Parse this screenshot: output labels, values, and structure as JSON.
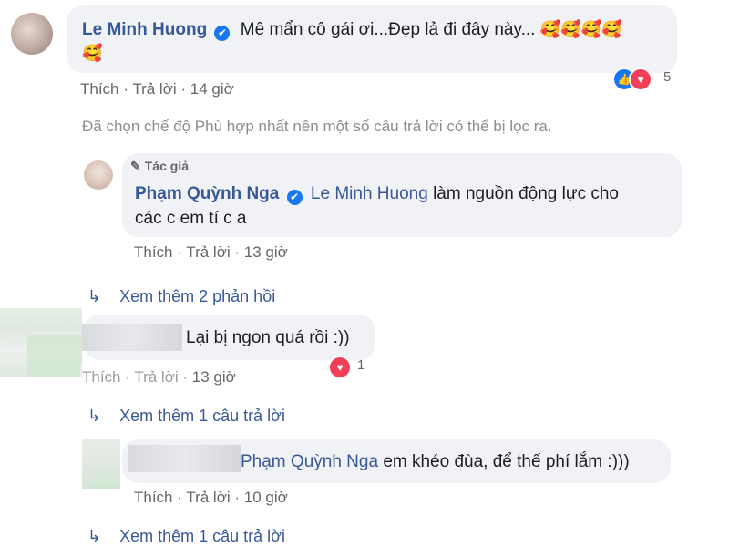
{
  "comment1": {
    "author": "Le Minh Huong",
    "text": "Mê mẩn cô gái ơi...Đẹp lả đi đây này...",
    "emoji": "🥰🥰🥰🥰",
    "emoji2": "🥰",
    "like": "Thích",
    "reply": "Trả lời",
    "time": "14 giờ",
    "reaction_count": "5"
  },
  "filter_notice": "Đã chọn chế độ Phù hợp nhất nên một số câu trả lời có thể bị lọc ra.",
  "reply1": {
    "badge": "Tác giả",
    "author": "Phạm Quỳnh Nga",
    "mention": "Le Minh Huong",
    "text_line1": "làm nguồn động lực cho",
    "text_line2": "các c em tí c a",
    "like": "Thích",
    "reply": "Trả lời",
    "time": "13 giờ"
  },
  "more1": "Xem thêm 2 phản hồi",
  "comment2": {
    "text": "Lại bị ngon quá rồi :))",
    "like": "Thích",
    "reply": "Trả lời",
    "time": "13 giờ",
    "reaction_count": "1"
  },
  "more2": "Xem thêm 1 câu trả lời",
  "reply2": {
    "mention": "Phạm Quỳnh Nga",
    "text": "em khéo đùa, để thế phí lắm :)))",
    "like": "Thích",
    "reply": "Trả lời",
    "time": "10 giờ"
  },
  "more3": "Xem thêm 1 câu trả lời",
  "colors": {
    "link": "#385898",
    "bubble": "#f0f2f5",
    "meta": "#65676b",
    "like_blue": "#1877f2",
    "love_red": "#f33e58"
  }
}
